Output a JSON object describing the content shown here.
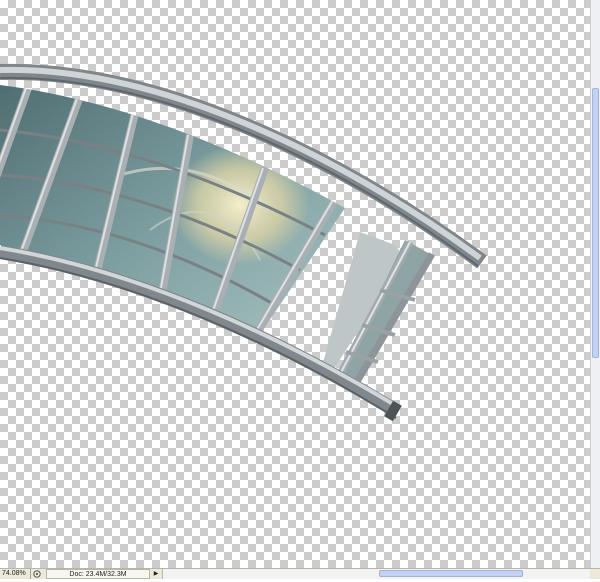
{
  "statusbar": {
    "zoom": "74.08%",
    "doc_info": "Doc: 23.4M/32.3M",
    "info_icon": "status-info-icon",
    "arrow_icon": "triangle-right-icon"
  },
  "canvas": {
    "background": "transparency-checkerboard",
    "subject": "curved-glass-roof-segment"
  },
  "colors": {
    "frame": "#8f969b",
    "frame_light": "#c8cdd0",
    "glass": "#6f8f93",
    "glass_light": "#9fbabc",
    "warm_glow": "#e8dfb4"
  }
}
